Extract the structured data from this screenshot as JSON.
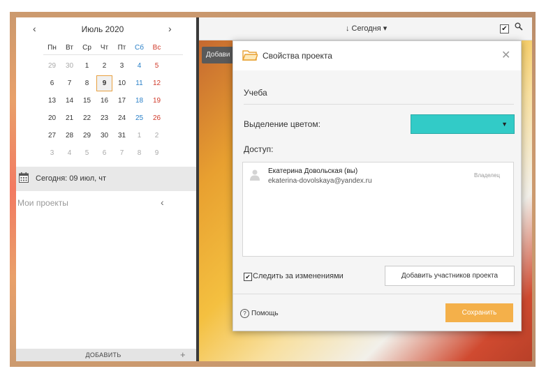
{
  "calendar": {
    "month_label": "Июль 2020",
    "prev": "‹",
    "next": "›",
    "weekdays": [
      "Пн",
      "Вт",
      "Ср",
      "Чт",
      "Пт",
      "Сб",
      "Вс"
    ],
    "weeks": [
      [
        {
          "d": "29",
          "t": "dim"
        },
        {
          "d": "30",
          "t": "dim"
        },
        {
          "d": "1",
          "t": ""
        },
        {
          "d": "2",
          "t": ""
        },
        {
          "d": "3",
          "t": ""
        },
        {
          "d": "4",
          "t": "sat"
        },
        {
          "d": "5",
          "t": "sun"
        }
      ],
      [
        {
          "d": "6",
          "t": ""
        },
        {
          "d": "7",
          "t": ""
        },
        {
          "d": "8",
          "t": ""
        },
        {
          "d": "9",
          "t": "sel"
        },
        {
          "d": "10",
          "t": ""
        },
        {
          "d": "11",
          "t": "sat"
        },
        {
          "d": "12",
          "t": "sun"
        }
      ],
      [
        {
          "d": "13",
          "t": ""
        },
        {
          "d": "14",
          "t": ""
        },
        {
          "d": "15",
          "t": ""
        },
        {
          "d": "16",
          "t": ""
        },
        {
          "d": "17",
          "t": ""
        },
        {
          "d": "18",
          "t": "sat"
        },
        {
          "d": "19",
          "t": "sun"
        }
      ],
      [
        {
          "d": "20",
          "t": ""
        },
        {
          "d": "21",
          "t": ""
        },
        {
          "d": "22",
          "t": ""
        },
        {
          "d": "23",
          "t": ""
        },
        {
          "d": "24",
          "t": ""
        },
        {
          "d": "25",
          "t": "sat"
        },
        {
          "d": "26",
          "t": "sun"
        }
      ],
      [
        {
          "d": "27",
          "t": ""
        },
        {
          "d": "28",
          "t": ""
        },
        {
          "d": "29",
          "t": ""
        },
        {
          "d": "30",
          "t": ""
        },
        {
          "d": "31",
          "t": ""
        },
        {
          "d": "1",
          "t": "dim"
        },
        {
          "d": "2",
          "t": "dim"
        }
      ],
      [
        {
          "d": "3",
          "t": "dim"
        },
        {
          "d": "4",
          "t": "dim"
        },
        {
          "d": "5",
          "t": "dim"
        },
        {
          "d": "6",
          "t": "dim"
        },
        {
          "d": "7",
          "t": "dim"
        },
        {
          "d": "8",
          "t": "dim"
        },
        {
          "d": "9",
          "t": "dim"
        }
      ]
    ]
  },
  "sidebar": {
    "today_label": "Сегодня: 09 июл, чт",
    "projects_label": "Мои проекты",
    "add_label": "ДОБАВИТЬ"
  },
  "topbar": {
    "sort_label": "↓ Сегодня ▾",
    "add_label": "Добави"
  },
  "modal": {
    "title": "Свойства проекта",
    "project_name": "Учеба",
    "color_label": "Выделение цветом:",
    "color_value": "#32cbc7",
    "access_label": "Доступ:",
    "member": {
      "name": "Екатерина Довольская (вы)",
      "email": "ekaterina-dovolskaya@yandex.ru",
      "role": "Владелец"
    },
    "watch_label": "Следить за изменениями",
    "watch_checked": true,
    "add_members_label": "Добавить участников проекта",
    "help_label": "Помощь",
    "save_label": "Сохранить"
  },
  "colors": {
    "accent_orange": "#f4b04a",
    "sat": "#2a80c8",
    "sun": "#d03a2a"
  }
}
